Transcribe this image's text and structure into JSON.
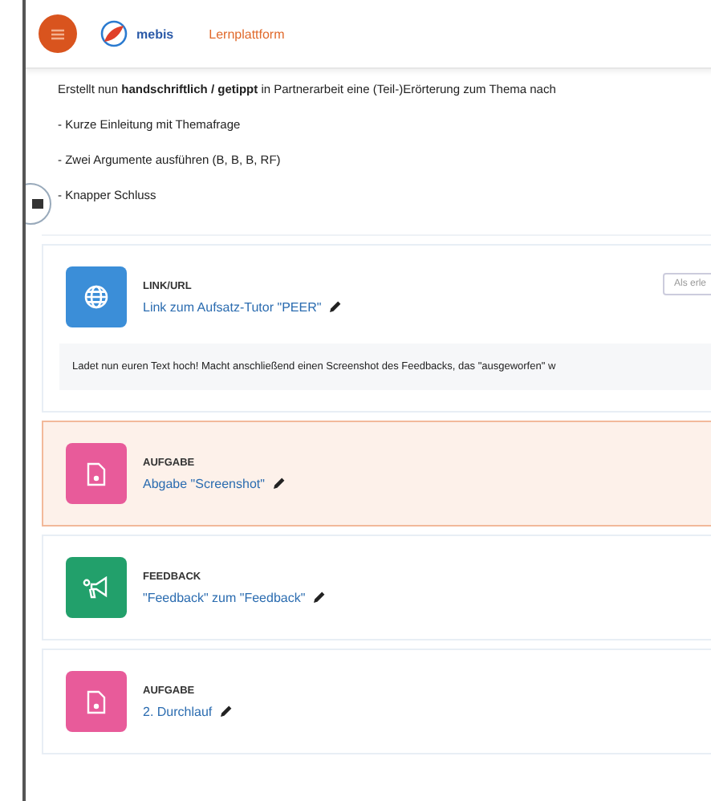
{
  "header": {
    "brand": "mebis",
    "section": "Lernplattform"
  },
  "intro": {
    "text": "Erstellt nun **handschriftlich / getippt** in Partnerarbeit eine (Teil-)Erörterung zum Thema nach",
    "points": [
      "- Kurze Einleitung mit Themafrage",
      "- Zwei Argumente ausführen (B, B, B, RF)",
      "- Knapper Schluss"
    ]
  },
  "activities": [
    {
      "kind": "link",
      "type_label": "LINK/URL",
      "title": "Link zum Aufsatz-Tutor \"PEER\"",
      "highlighted": false,
      "button": "Als erle",
      "description": "Ladet nun euren Text hoch! Macht anschließend einen Screenshot des Feedbacks, das \"ausgeworfen\" w"
    },
    {
      "kind": "assignment",
      "type_label": "AUFGABE",
      "title": "Abgabe \"Screenshot\"",
      "highlighted": true
    },
    {
      "kind": "feedback",
      "type_label": "FEEDBACK",
      "title": "\"Feedback\" zum \"Feedback\"",
      "highlighted": false
    },
    {
      "kind": "assignment",
      "type_label": "AUFGABE",
      "title": "2. Durchlauf",
      "highlighted": false
    }
  ]
}
